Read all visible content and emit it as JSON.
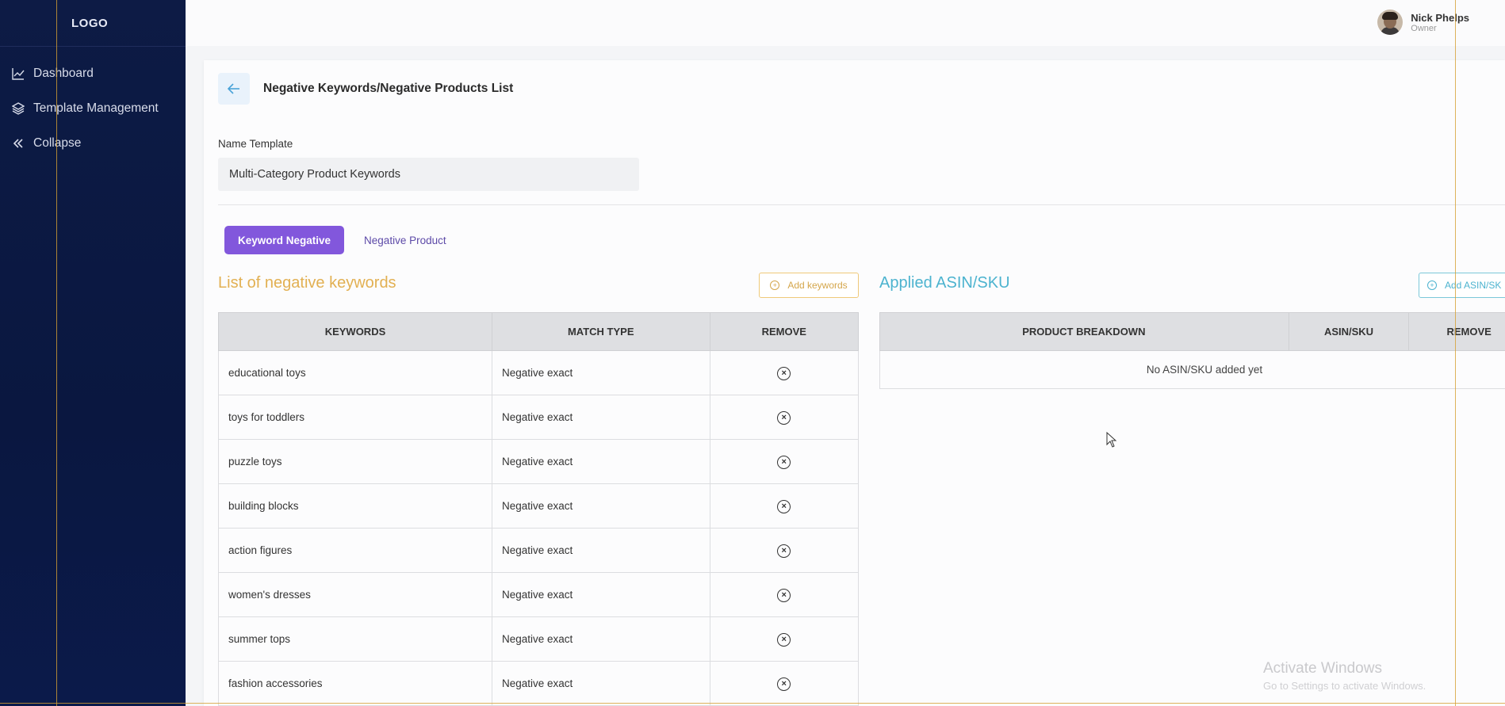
{
  "sidebar": {
    "logo": "LOGO",
    "items": [
      {
        "label": "Dashboard",
        "icon": "chart-line-icon"
      },
      {
        "label": "Template Management",
        "icon": "layers-icon"
      },
      {
        "label": "Collapse",
        "icon": "double-chevron-left-icon"
      }
    ]
  },
  "user": {
    "name": "Nick Phelps",
    "role": "Owner"
  },
  "page": {
    "title": "Negative Keywords/Negative Products List",
    "name_label": "Name Template",
    "name_value": "Multi-Category Product Keywords"
  },
  "tabs": [
    {
      "label": "Keyword Negative",
      "active": true
    },
    {
      "label": "Negative Product",
      "active": false
    }
  ],
  "keywords_section": {
    "title": "List of negative keywords",
    "add_label": "Add keywords",
    "headers": [
      "KEYWORDS",
      "MATCH TYPE",
      "REMOVE"
    ],
    "rows": [
      {
        "keyword": "educational toys",
        "match": "Negative exact"
      },
      {
        "keyword": "toys for toddlers",
        "match": "Negative exact"
      },
      {
        "keyword": "puzzle toys",
        "match": "Negative exact"
      },
      {
        "keyword": "building blocks",
        "match": "Negative exact"
      },
      {
        "keyword": "action figures",
        "match": "Negative exact"
      },
      {
        "keyword": "women's dresses",
        "match": "Negative exact"
      },
      {
        "keyword": "summer tops",
        "match": "Negative exact"
      },
      {
        "keyword": "fashion accessories",
        "match": "Negative exact"
      }
    ]
  },
  "asin_section": {
    "title": "Applied ASIN/SKU",
    "add_label": "Add ASIN/SK",
    "headers": [
      "PRODUCT BREAKDOWN",
      "ASIN/SKU",
      "REMOVE"
    ],
    "empty_message": "No ASIN/SKU added yet"
  },
  "watermark": {
    "title": "Activate Windows",
    "subtitle": "Go to Settings to activate Windows."
  },
  "colors": {
    "sidebar_bg": "#0d1b45",
    "tab_active": "#8257dc",
    "keywords_title": "#e2b052",
    "asin_title": "#4cb3cf"
  }
}
